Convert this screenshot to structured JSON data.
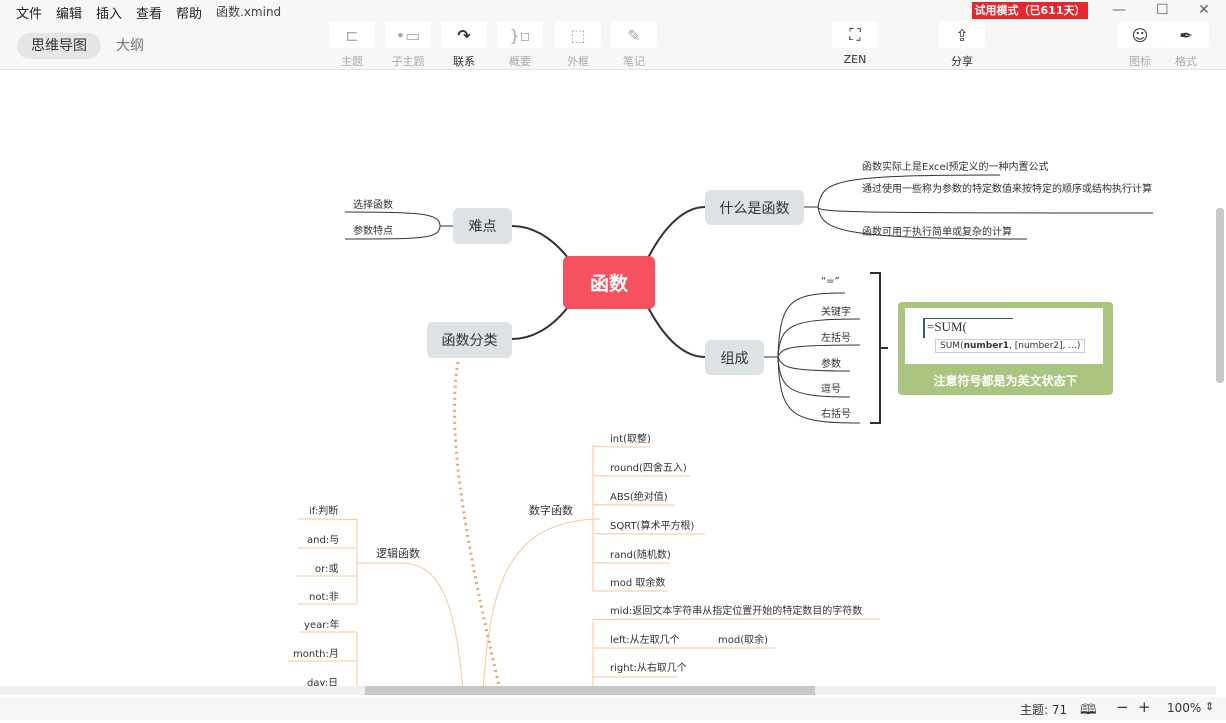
{
  "menu": [
    "文件",
    "编辑",
    "插入",
    "查看",
    "帮助"
  ],
  "file_name": "函数.xmind",
  "view_tabs": {
    "mindmap": "思维导图",
    "outline": "大纲"
  },
  "toolbar": {
    "topic": "主题",
    "subtopic": "子主题",
    "relation": "联系",
    "summary": "概要",
    "boundary": "外框",
    "note": "笔记",
    "zen": "ZEN",
    "share": "分享",
    "icon": "图标",
    "format": "格式"
  },
  "trial_badge": "试用模式（已611天）",
  "map": {
    "root": "函数",
    "difficulty": {
      "label": "难点",
      "children": [
        "选择函数",
        "参数特点"
      ]
    },
    "category": {
      "label": "函数分类"
    },
    "what": {
      "label": "什么是函数",
      "children": [
        "函数实际上是Excel预定义的一种内置公式",
        "通过使用一些称为参数的特定数值来按特定的顺序或结构执行计算",
        "函数可用于执行简单或复杂的计算"
      ]
    },
    "compose": {
      "label": "组成",
      "children": [
        "“=”",
        "关键字",
        "左括号",
        "参数",
        "逗号",
        "右括号"
      ]
    },
    "image": {
      "formula": "=SUM(",
      "tooltip_fn": "SUM(",
      "tooltip_bold": "number1",
      "tooltip_rest": ", [number2], ...)",
      "caption": "注意符号都是为英文状态下"
    },
    "number_funcs": {
      "label": "数字函数",
      "children": [
        "int(取整)",
        "round(四舍五入)",
        "ABS(绝对值)",
        "SQRT(算术平方根)",
        "rand(随机数)",
        "mod 取余数"
      ]
    },
    "text_funcs": [
      "mid:返回文本字符串从指定位置开始的特定数目的字符数",
      "left:从左取几个",
      "right:从右取几个"
    ],
    "extra_note": "mod(取余)",
    "logic_funcs": {
      "label": "逻辑函数",
      "children": [
        "if:判断",
        "and:与",
        "or:或",
        "not:非"
      ]
    },
    "date_funcs": [
      "year:年",
      "month:月",
      "day:日"
    ]
  },
  "status": {
    "topics": "主题: 71",
    "zoom": "100%"
  },
  "colors": {
    "root": "#f5515f",
    "node": "#dde2e5",
    "branch": "#f3c89e",
    "dotted": "#e9a66a",
    "image_bg": "#a9c57f"
  }
}
